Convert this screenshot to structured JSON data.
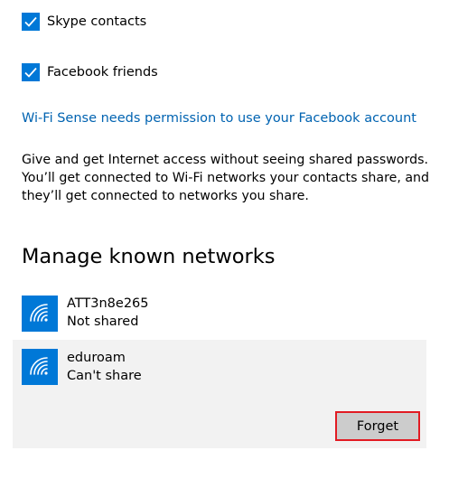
{
  "wifi_sense": {
    "checkboxes": [
      {
        "label": "Skype contacts",
        "checked": true
      },
      {
        "label": "Facebook friends",
        "checked": true
      }
    ],
    "facebook_link": "Wi-Fi Sense needs permission to use your Facebook account",
    "description_lines": [
      "Give and get Internet access without seeing shared passwords.",
      "You’ll get connected to Wi-Fi networks your contacts share, and",
      "they’ll get connected to networks you share."
    ]
  },
  "known_networks": {
    "title": "Manage known networks",
    "items": [
      {
        "name": "ATT3n8e265",
        "status": "Not shared",
        "icon": "wifi-icon",
        "selected": false
      },
      {
        "name": "eduroam",
        "status": "Can't share",
        "icon": "wifi-icon",
        "selected": true
      }
    ],
    "forget_label": "Forget"
  },
  "colors": {
    "accent": "#0078d7",
    "link": "#0063b1",
    "selected_background": "#f2f2f2",
    "button_background": "#cccccc",
    "highlight_border": "#e21b23"
  }
}
